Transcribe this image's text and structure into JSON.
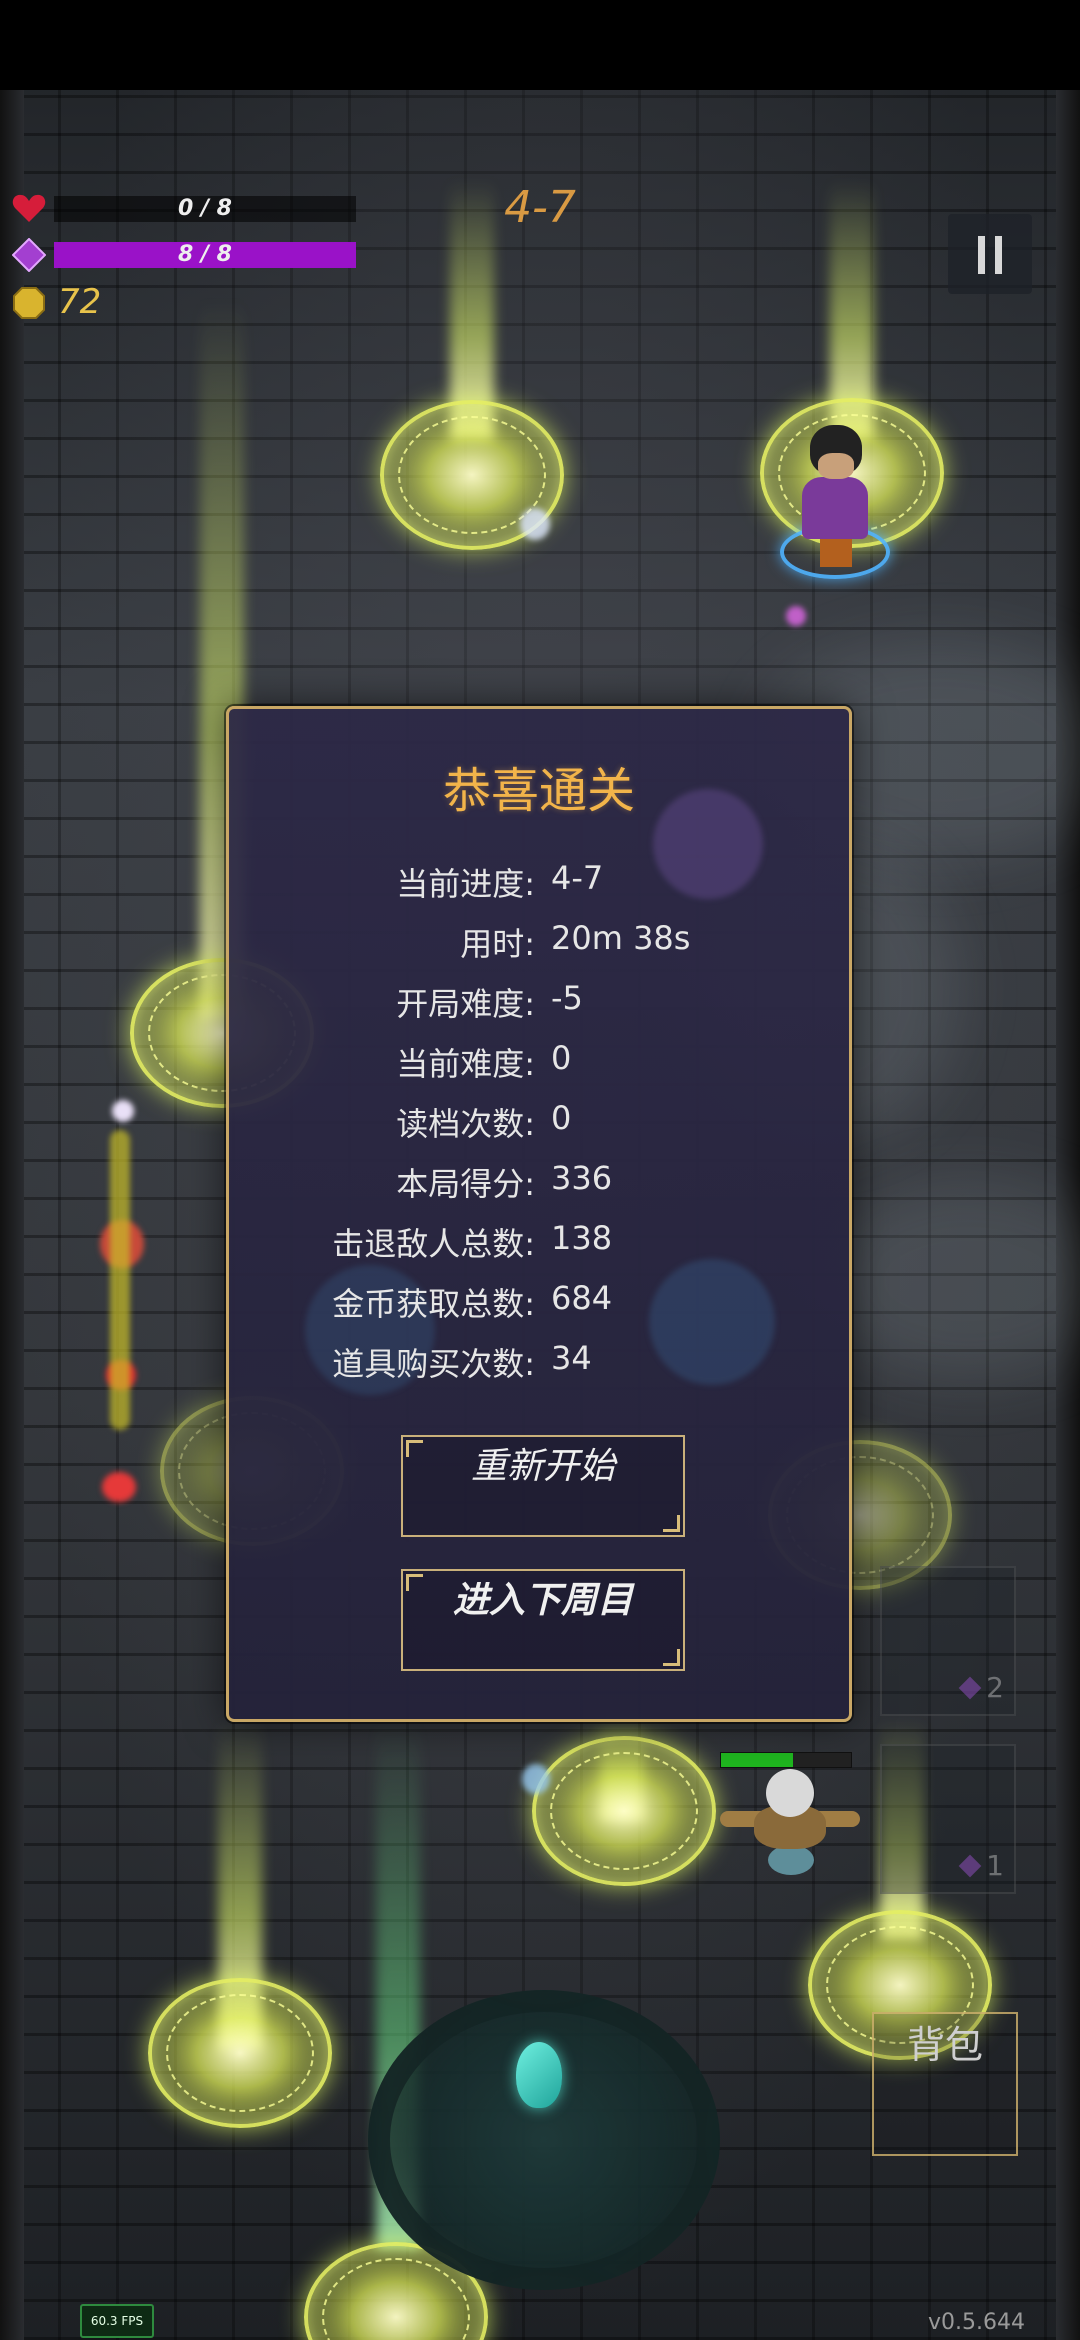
{
  "hud": {
    "health_text": "0 / 8",
    "health_fraction": 0,
    "mana_text": "8 / 8",
    "mana_fraction": 1,
    "coins": "72",
    "level": "4-7"
  },
  "dialog": {
    "title": "恭喜通关",
    "stats": [
      {
        "label": "当前进度:",
        "value": "4-7"
      },
      {
        "label": "用时:",
        "value": "20m 38s"
      },
      {
        "label": "开局难度:",
        "value": "-5"
      },
      {
        "label": "当前难度:",
        "value": "0"
      },
      {
        "label": "读档次数:",
        "value": "0"
      },
      {
        "label": "本局得分:",
        "value": "336"
      },
      {
        "label": "击退敌人总数:",
        "value": "138"
      },
      {
        "label": "金币获取总数:",
        "value": "684"
      },
      {
        "label": "道具购买次数:",
        "value": "34"
      }
    ],
    "restart_label": "重新开始",
    "next_cycle_label": "进入下周目"
  },
  "skill_slots": [
    {
      "count": "2"
    },
    {
      "count": "1"
    }
  ],
  "enemy": {
    "health_fraction": 0.55
  },
  "bag_label": "背包",
  "fps_text": "60.3 FPS",
  "version_text": "v0.5.644",
  "colors": {
    "accent_gold": "#f2b44a",
    "level_orange": "#d99a43",
    "mana_purple": "#9a12c8",
    "dialog_border": "#c9a765",
    "coin_yellow": "#e8c34b"
  },
  "icons": {
    "health": "heart-icon",
    "mana": "diamond-gem-icon",
    "coins": "coin-icon",
    "pause": "pause-icon"
  }
}
